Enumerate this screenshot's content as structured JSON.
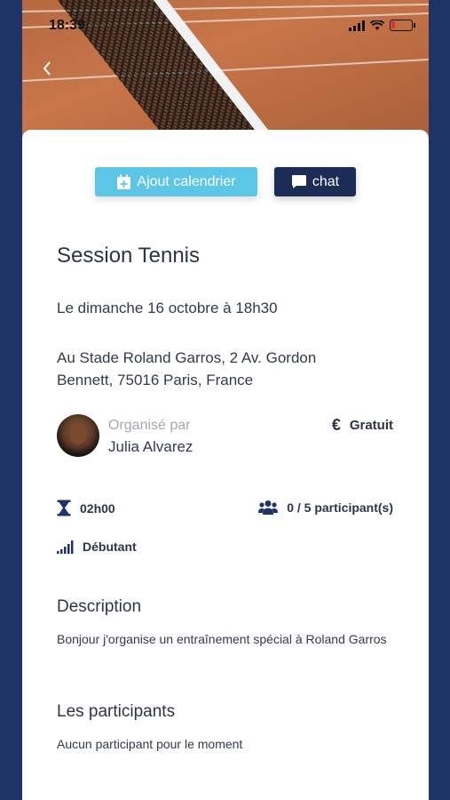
{
  "status_bar": {
    "time": "18:39"
  },
  "actions": {
    "calendar_label": "Ajout calendrier",
    "chat_label": "chat"
  },
  "event": {
    "title": "Session Tennis",
    "date": "Le dimanche 16 octobre à 18h30",
    "address": "Au Stade Roland Garros, 2 Av. Gordon Bennett, 75016 Paris, France",
    "organizer_label": "Organisé par",
    "organizer_name": "Julia Alvarez",
    "price_symbol": "€",
    "price": "Gratuit",
    "duration": "02h00",
    "participants": "0 / 5 participant(s)",
    "level": "Débutant"
  },
  "description": {
    "title": "Description",
    "text": "Bonjour j'organise un entraînement spécial à Roland Garros"
  },
  "participants_section": {
    "title": "Les participants",
    "empty_text": "Aucun participant pour le moment"
  },
  "colors": {
    "navy": "#1f3466",
    "accent": "#5cc6e6",
    "button_dark": "#1b2d57"
  }
}
